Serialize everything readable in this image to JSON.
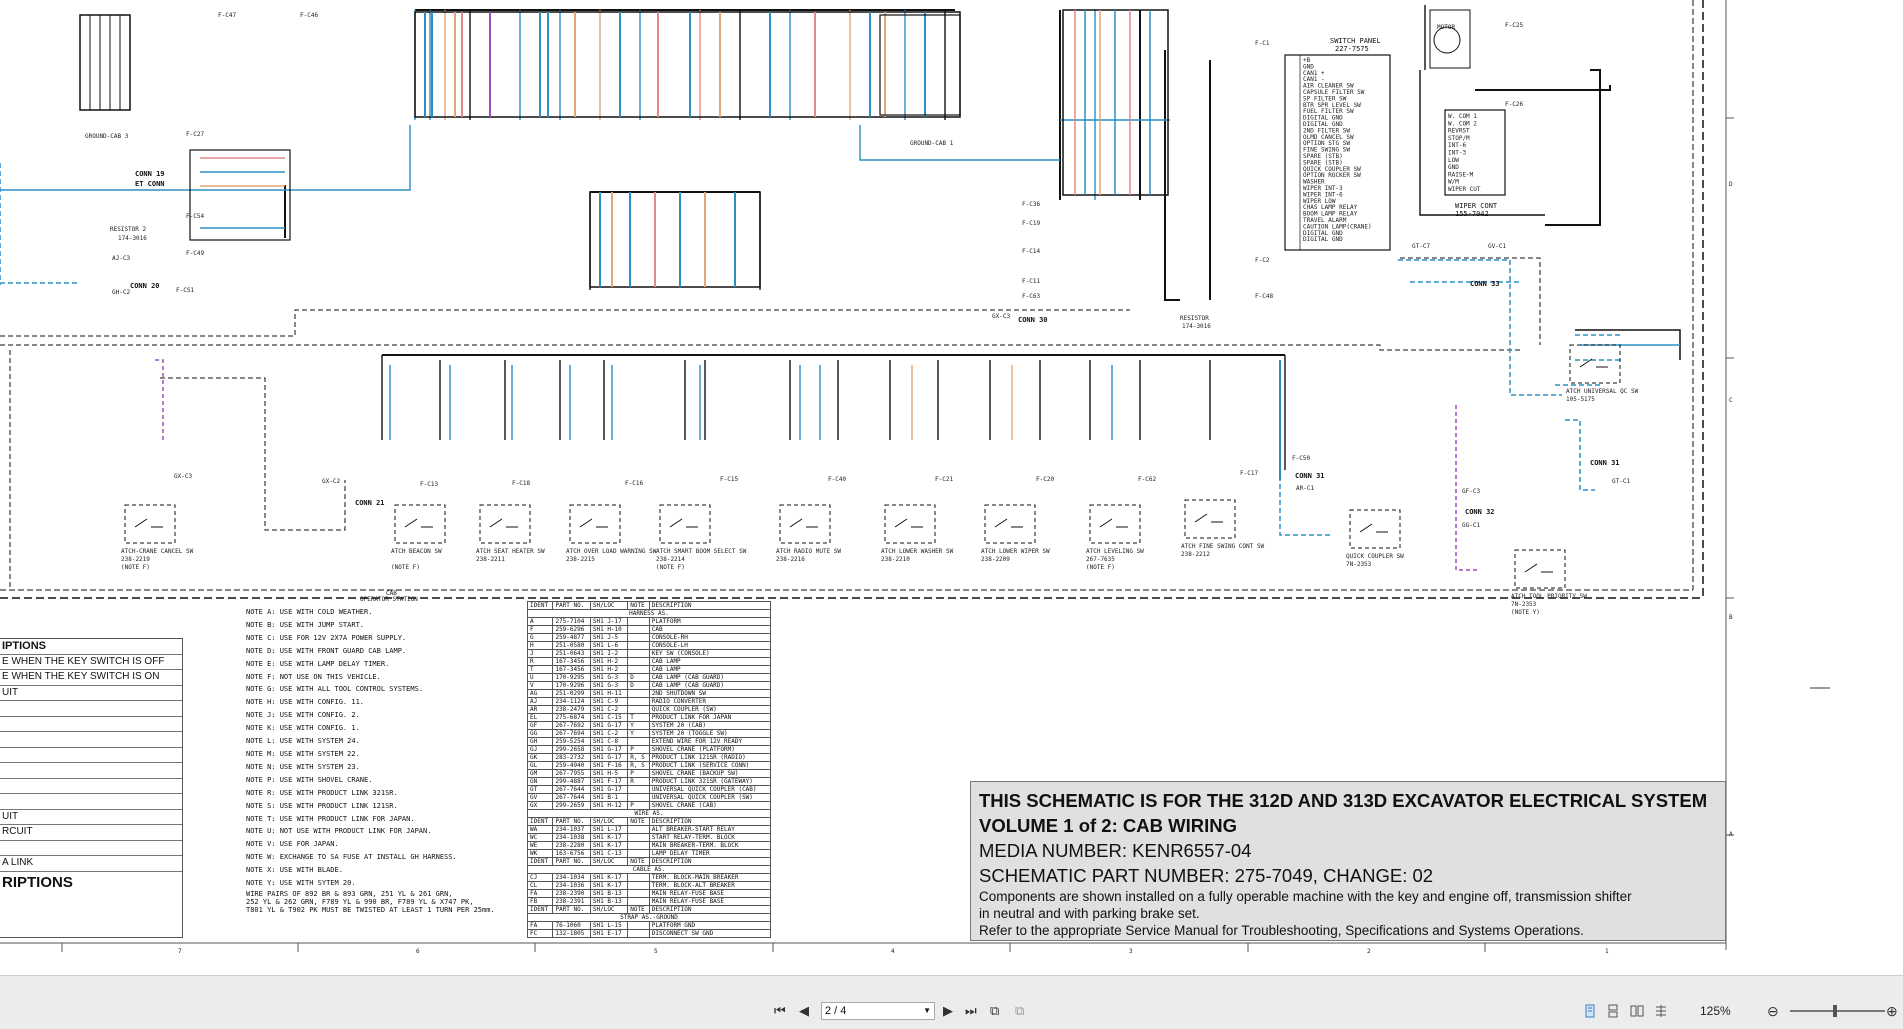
{
  "title_block": {
    "line1": "THIS SCHEMATIC IS FOR THE 312D AND 313D EXCAVATOR ELECTRICAL SYSTEM",
    "line2": "VOLUME 1 of 2: CAB WIRING",
    "line3": "MEDIA NUMBER: KENR6557-04",
    "line4": "SCHEMATIC PART NUMBER: 275-7049, CHANGE: 02",
    "line5": "Components are shown installed on a fully operable machine with the key and engine off, transmission shifter",
    "line6": "in neutral and with parking brake set.",
    "line7": "Refer to the appropriate Service Manual for Troubleshooting, Specifications and Systems Operations."
  },
  "connectors": {
    "conn19": "CONN 19",
    "et_conn": "ET CONN",
    "conn20": "CONN 20",
    "conn21": "CONN 21",
    "conn30": "CONN 30",
    "conn31a": "CONN 31",
    "conn31b": "CONN 31",
    "conn32": "CONN 32",
    "conn33": "CONN 33",
    "resistor1": "RESISTOR 2",
    "resistor1_pn": "174-3016",
    "resistor2": "RESISTOR",
    "resistor2_pn": "174-3016",
    "ground_cab3": "GROUND-CAB 3",
    "ground_cab1": "GROUND-CAB 1",
    "switch_panel": "SWITCH PANEL",
    "switch_panel_pn": "227-7575",
    "wiper_cont": "WIPER CONT",
    "wiper_cont_pn": "155-7042",
    "motor": "MOTOR",
    "cab_station": "CAB",
    "operator_station": "OPERATOR STATION"
  },
  "switch_panel_labels": [
    "+B",
    "GND",
    "CAN1 +",
    "CAN1 -",
    "AIR CLEANER SW",
    "CAPSULE FILTER SW",
    "SP FILTER SW",
    "BTR SPR LEVEL SW",
    "FUEL FILTER SW",
    "DIGITAL GND",
    "DIGITAL GND",
    "2ND FILTER SW",
    "OLMD CANCEL SW",
    "OPTION STG SW",
    "FINE SWING SW",
    "SPARE (STB)",
    "SPARE (STB)",
    "QUICK COUPLER SW",
    "OPTION ROCKER SW",
    "WASHER",
    "WIPER INT-3",
    "WIPER INT-6",
    "WIPER LOW",
    "CHAS LAMP RELAY",
    "BOOM LAMP RELAY",
    "TRAVEL ALARM",
    "CAUTION LAMP(CRANE)",
    "DIGITAL GND",
    "DIGITAL GND"
  ],
  "wiper_cont_labels": [
    "W. COM 1",
    "W. COM 2",
    "REVRST",
    "STOP/M",
    "INT-6",
    "INT-3",
    "LOW",
    "GND",
    "RAISE-M",
    "W/M",
    "WIPER CUT"
  ],
  "bottom_components": [
    {
      "name": "ATCH-CRANE CANCEL SW",
      "pn": "238-2219",
      "note": "(NOTE F)"
    },
    {
      "name": "ATCH BEACON SW",
      "pn": "",
      "note": "(NOTE F)"
    },
    {
      "name": "ATCH SEAT HEATER SW",
      "pn": "238-2211",
      "note": ""
    },
    {
      "name": "ATCH OVER LOAD WARNING SW",
      "pn": "238-2215",
      "note": ""
    },
    {
      "name": "ATCH SMART BOOM SELECT SW",
      "pn": "238-2214",
      "note": "(NOTE F)"
    },
    {
      "name": "ATCH RADIO MUTE SW",
      "pn": "238-2216",
      "note": ""
    },
    {
      "name": "ATCH LOWER WASHER SW",
      "pn": "238-2210",
      "note": ""
    },
    {
      "name": "ATCH LOWER WIPER SW",
      "pn": "238-2209",
      "note": ""
    },
    {
      "name": "ATCH LEVELING SW",
      "pn": "267-7635",
      "note": "(NOTE F)"
    },
    {
      "name": "ATCH FINE SWING CONT SW",
      "pn": "238-2212",
      "note": ""
    },
    {
      "name": "QUICK COUPLER SW",
      "pn": "7N-2353",
      "note": ""
    },
    {
      "name": "ATCH TOOL PRIORITY SW",
      "pn": "7N-2353",
      "note": "(NOTE Y)"
    },
    {
      "name": "ATCH UNIVERSAL QC SW",
      "pn": "105-5175",
      "note": ""
    }
  ],
  "connector_ids": [
    "F-C27",
    "F-C54",
    "F-C49",
    "AJ-C3",
    "GH-C2",
    "F-CS1",
    "GX-C3",
    "GX-C2",
    "F-C13",
    "F-C18",
    "F-C16",
    "F-C15",
    "F-C40",
    "F-C21",
    "F-C20",
    "F-C62",
    "F-C17",
    "F-C50",
    "AR-C1",
    "GF-C3",
    "GG-C1",
    "GT-C1",
    "GT-C7",
    "GV-C1",
    "F-C1",
    "F-C2",
    "F-C48",
    "F-C25",
    "F-C26",
    "F-C36",
    "F-C19",
    "F-C14",
    "F-C11",
    "F-C63",
    "GX-C3",
    "F-C47",
    "F-C46"
  ],
  "notes": [
    "NOTE A: USE WITH COLD WEATHER.",
    "NOTE B: USE WITH JUMP START.",
    "NOTE C: USE FOR 12V 2X7A POWER SUPPLY.",
    "NOTE D: USE WITH FRONT GUARD CAB LAMP.",
    "NOTE E: USE WITH LAMP DELAY TIMER.",
    "NOTE F: NOT USE ON THIS VEHICLE.",
    "NOTE G: USE WITH ALL TOOL CONTROL SYSTEMS.",
    "NOTE H: USE WITH CONFIG. 11.",
    "NOTE J: USE WITH CONFIG. 2.",
    "NOTE K: USE WITH CONFIG. 1.",
    "NOTE L: USE WITH SYSTEM 24.",
    "NOTE M: USE WITH SYSTEM 22.",
    "NOTE N: USE WITH SYSTEM 23.",
    "NOTE P: USE WITH SHOVEL CRANE.",
    "NOTE R: USE WITH PRODUCT LINK 321SR.",
    "NOTE S: USE WITH PRODUCT LINK 121SR.",
    "NOTE T: USE WITH PRODUCT LINK FOR JAPAN.",
    "NOTE U: NOT USE WITH PRODUCT LINK FOR JAPAN.",
    "NOTE V: USE FOR JAPAN.",
    "NOTE W: EXCHANGE TO SA FUSE AT INSTALL GH HARNESS.",
    "NOTE X: USE WITH BLADE.",
    "NOTE Y: USE WITH SYTEM 20."
  ],
  "notes_extra": [
    "WIRE PAIRS OF 892 BR & 893 GRN, 251 YL & 261 GRN,",
    "252 YL & 262 GRN, F789 YL & 990 BR, F789 YL & X747 PK,",
    "T801 YL & T902 PK MUST BE TWISTED AT LEAST 1 TURN PER 25mm."
  ],
  "left_description": {
    "header": "IPTIONS",
    "rows": [
      "E WHEN THE KEY SWITCH IS OFF",
      "E WHEN THE KEY SWITCH IS ON",
      "UIT",
      "",
      "",
      "",
      "",
      "",
      "",
      "",
      "UIT",
      "RCUIT",
      "",
      "A LINK"
    ],
    "footer": "RIPTIONS"
  },
  "parts_table": {
    "headers": [
      "IDENT",
      "PART NO.",
      "SH/LOC",
      "NOTE",
      "DESCRIPTION"
    ],
    "section_harness": "HARNESS AS.",
    "harness": [
      [
        "A",
        "275-7104",
        "SH1 J-17",
        "",
        "PLATFORM"
      ],
      [
        "F",
        "259-6296",
        "SH1 H-10",
        "",
        "CAB"
      ],
      [
        "G",
        "259-4877",
        "SH1 J-5",
        "",
        "CONSOLE-RH"
      ],
      [
        "H",
        "251-0580",
        "SH1 L-6",
        "",
        "CONSOLE-LH"
      ],
      [
        "J",
        "251-0643",
        "SH1 I-2",
        "",
        "KEY SW (CONSOLE)"
      ],
      [
        "R",
        "167-3456",
        "SH1 H-2",
        "",
        "CAB LAMP"
      ],
      [
        "T",
        "167-3456",
        "SH1 H-2",
        "",
        "CAB LAMP"
      ],
      [
        "U",
        "170-9295",
        "SH1 G-3",
        "D",
        "CAB LAMP (CAB GUARD)"
      ],
      [
        "V",
        "170-9296",
        "SH1 G-3",
        "D",
        "CAB LAMP (CAB GUARD)"
      ],
      [
        "AG",
        "251-0299",
        "SH1 H-11",
        "",
        "2ND SHUTDOWN SW"
      ],
      [
        "AJ",
        "234-1124",
        "SH1 C-9",
        "",
        "RADIO CONVERTER"
      ],
      [
        "AR",
        "238-2479",
        "SH1 C-2",
        "",
        "QUICK COUPLER (SW)"
      ],
      [
        "EL",
        "275-6874",
        "SH1 C-15",
        "T",
        "PRODUCT LINK FOR JAPAN"
      ],
      [
        "GF",
        "267-7692",
        "SH1 G-17",
        "Y",
        "SYSTEM 20 (CAB)"
      ],
      [
        "GG",
        "267-7694",
        "SH1 C-2",
        "Y",
        "SYSTEM 20 (TOGGLE SW)"
      ],
      [
        "GH",
        "259-5254",
        "SH1 C-8",
        "",
        "EXTEND WIRE FOR 12V READY"
      ],
      [
        "GJ",
        "299-2658",
        "SH1 G-17",
        "P",
        "SHOVEL CRANE (PLATFORM)"
      ],
      [
        "GK",
        "283-2732",
        "SH1 G-17",
        "R, S",
        "PRODUCT LINK 121SR (RADIO)"
      ],
      [
        "GL",
        "259-4940",
        "SH1 F-16",
        "R, S",
        "PRODUCT LINK (SERVICE CONN)"
      ],
      [
        "GM",
        "267-7955",
        "SH1 H-5",
        "P",
        "SHOVEL CRANE (BACKUP SW)"
      ],
      [
        "GN",
        "299-4887",
        "SH1 F-17",
        "R",
        "PRODUCT LINK 321SR (GATEWAY)"
      ],
      [
        "GT",
        "267-7644",
        "SH1 G-17",
        "",
        "UNIVERSAL QUICK COUPLER (CAB)"
      ],
      [
        "GV",
        "267-7644",
        "SH1 B-1",
        "",
        "UNIVERSAL QUICK COUPLER (SW)"
      ],
      [
        "GX",
        "299-2659",
        "SH1 H-12",
        "P",
        "SHOVEL CRANE (CAB)"
      ]
    ],
    "section_wire": "WIRE AS.",
    "wire": [
      [
        "WA",
        "234-1037",
        "SH1 L-17",
        "",
        "ALT BREAKER-START RELAY"
      ],
      [
        "WC",
        "234-1038",
        "SH1 K-17",
        "",
        "START RELAY-TERM. BLOCK"
      ],
      [
        "WE",
        "238-2280",
        "SH1 K-17",
        "",
        "MAIN BREAKER-TERM. BLOCK"
      ],
      [
        "WK",
        "163-6756",
        "SH1 C-13",
        "",
        "LAMP DELAY TIMER"
      ]
    ],
    "section_cable": "CABLE AS.",
    "cable": [
      [
        "CJ",
        "234-1034",
        "SH1 K-17",
        "",
        "TERM. BLOCK-MAIN BREAKER"
      ],
      [
        "CL",
        "234-1036",
        "SH1 K-17",
        "",
        "TERM. BLOCK-ALT BREAKER"
      ],
      [
        "FA",
        "238-2390",
        "SH1 B-13",
        "",
        "MAIN RELAY-FUSE BASE"
      ],
      [
        "FB",
        "238-2391",
        "SH1 B-13",
        "",
        "MAIN RELAY-FUSE BASE"
      ]
    ],
    "section_strap": "STRAP AS.-GROUND",
    "strap": [
      [
        "FA",
        "76-1060",
        "SH1 L-15",
        "",
        "PLATFORM GND"
      ],
      [
        "FC",
        "132-1805",
        "SH1 E-17",
        "",
        "DISCONNECT SW GND"
      ]
    ]
  },
  "grid_columns": [
    "7",
    "6",
    "5",
    "4",
    "3",
    "2",
    "1"
  ],
  "grid_rows": [
    "D",
    "C",
    "B",
    "A"
  ],
  "viewer": {
    "page_value": "2 / 4",
    "zoom": "125%",
    "icons": [
      "first-page-icon",
      "prev-page-icon",
      "next-page-icon",
      "last-page-icon",
      "fit-page-icon",
      "fit-width-icon",
      "single-page-icon",
      "continuous-icon",
      "two-page-icon",
      "scroll-mode-icon",
      "zoom-out-icon",
      "zoom-in-icon"
    ]
  }
}
